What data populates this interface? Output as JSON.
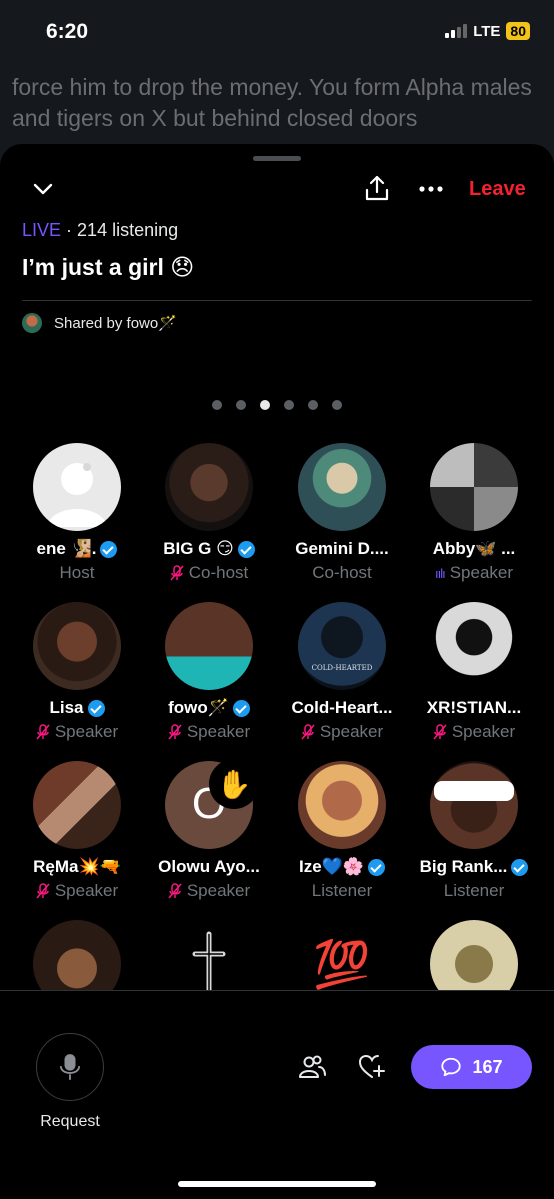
{
  "status_bar": {
    "time": "6:20",
    "network": "LTE",
    "battery": "80"
  },
  "background_tweet": {
    "text": "force him to drop the money. You form Alpha males and tigers on X but behind closed doors"
  },
  "space": {
    "live_label": "LIVE",
    "listening": "· 214 listening",
    "title": "I’m just a girl 😞",
    "shared_by": "Shared by fowo🪄",
    "leave_label": "Leave",
    "page_dots": 6,
    "active_dot": 3
  },
  "participants": [
    {
      "name": "ene 🧏🏼.",
      "verified": true,
      "role": "Host",
      "role_icon": "none",
      "avatar": "placeholder"
    },
    {
      "name": "BIG G 😏",
      "verified": true,
      "role": "Co-host",
      "role_icon": "mic-off"
    },
    {
      "name": "Gemini D....",
      "verified": false,
      "role": "Co-host",
      "role_icon": "none"
    },
    {
      "name": "Abby🦋 ...",
      "verified": false,
      "role": "Speaker",
      "role_icon": "speaking"
    },
    {
      "name": "Lisa",
      "verified": true,
      "role": "Speaker",
      "role_icon": "mic-off"
    },
    {
      "name": "fowo🪄",
      "verified": true,
      "role": "Speaker",
      "role_icon": "mic-off"
    },
    {
      "name": "Cold-Heart...",
      "verified": false,
      "role": "Speaker",
      "role_icon": "mic-off",
      "avatar_text": "COLD-HEARTED"
    },
    {
      "name": "XR!STIAN...",
      "verified": false,
      "role": "Speaker",
      "role_icon": "mic-off"
    },
    {
      "name": "RęMa💥🔫",
      "verified": false,
      "role": "Speaker",
      "role_icon": "mic-off"
    },
    {
      "name": "Olowu Ayo...",
      "verified": false,
      "role": "Speaker",
      "role_icon": "mic-off",
      "avatar_letter": "O",
      "hand_raised": "✋"
    },
    {
      "name": "Ize💙🌸",
      "verified": true,
      "role": "Listener",
      "role_icon": "none"
    },
    {
      "name": "Big Rank...",
      "verified": true,
      "role": "Listener",
      "role_icon": "none"
    },
    {
      "name": "",
      "role": ""
    },
    {
      "name": "",
      "role": ""
    },
    {
      "name": "",
      "role": "",
      "avatar_emoji": "💯"
    },
    {
      "name": "",
      "role": ""
    }
  ],
  "bottom_bar": {
    "request_label": "Request",
    "comment_count": "167"
  },
  "colors": {
    "accent": "#7856ff",
    "leave": "#f4212e",
    "verified": "#1d9bf0",
    "muted": "#71767b"
  }
}
